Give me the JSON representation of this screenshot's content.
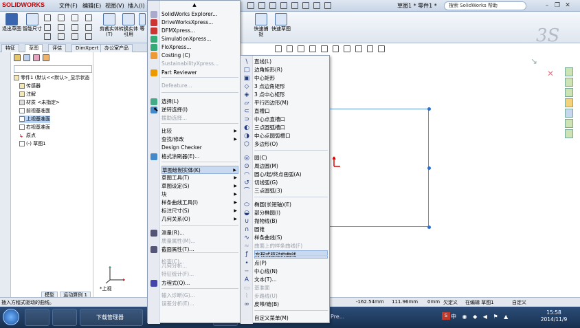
{
  "titlebar": {
    "logo": "SOLIDWORKS",
    "menus": [
      "文件(F)",
      "编辑(E)",
      "视图(V)",
      "插入(I)"
    ],
    "doc_title": "草图1 * 零件1 *",
    "help_search": "搜索 SolidWorks 帮助"
  },
  "cmdbar": {
    "exit_sketch": "退出草图",
    "smart_dim": "智能尺寸",
    "trim": "剪裁实体(T)",
    "convert": "转换实体引用",
    "equal": "等",
    "rapid_snap": "快速捕捉",
    "rapid_sketch": "快速草图"
  },
  "tabs": [
    "特征",
    "草图",
    "评估",
    "DimXpert",
    "办公室产品"
  ],
  "tree": {
    "part": "零件1 (默认<<默认>_显示状态",
    "items": [
      "传感器",
      "注解",
      "材质 <未指定>",
      "前视基准面",
      "上视基准面",
      "右视基准面",
      "原点",
      "(-) 草图1"
    ]
  },
  "mainmenu": {
    "items": [
      {
        "label": "SolidWorks Explorer...",
        "disabled": false
      },
      {
        "label": "DriveWorksXpress...",
        "disabled": false
      },
      {
        "label": "DFMXpress...",
        "disabled": false
      },
      {
        "label": "SimulationXpress...",
        "disabled": false
      },
      {
        "label": "FloXpress...",
        "disabled": false
      },
      {
        "label": "Costing (C)",
        "disabled": false
      },
      {
        "label": "SustainabilityXpress...",
        "disabled": true
      },
      {
        "label": "Part Reviewer",
        "disabled": false
      },
      {
        "label": "Defeature...",
        "disabled": true
      },
      {
        "label": "选择(L)",
        "disabled": false
      },
      {
        "label": "逆转选择(I)",
        "disabled": false
      },
      {
        "label": "援助选择...",
        "disabled": true
      },
      {
        "label": "比较",
        "disabled": false
      },
      {
        "label": "查找/修改",
        "disabled": false
      },
      {
        "label": "Design Checker",
        "disabled": false
      },
      {
        "label": "格式涂刷器(E)...",
        "disabled": false
      },
      {
        "label": "草图绘制实体(K)",
        "disabled": false
      },
      {
        "label": "草图工具(T)",
        "disabled": false
      },
      {
        "label": "草图设定(S)",
        "disabled": false
      },
      {
        "label": "块",
        "disabled": false
      },
      {
        "label": "样条曲线工具(I)",
        "disabled": false
      },
      {
        "label": "标注尺寸(S)",
        "disabled": false
      },
      {
        "label": "几何关系(O)",
        "disabled": false
      },
      {
        "label": "测量(R)...",
        "disabled": false
      },
      {
        "label": "质量属性(M)...",
        "disabled": true
      },
      {
        "label": "截面属性(T)...",
        "disabled": false
      },
      {
        "label": "检查(C)...",
        "disabled": true
      },
      {
        "label": "几何分析...",
        "disabled": true
      },
      {
        "label": "特征统计(F)...",
        "disabled": true
      },
      {
        "label": "方程式(Q)...",
        "disabled": false
      },
      {
        "label": "输入诊断(G)...",
        "disabled": true
      },
      {
        "label": "误差分析(E)...",
        "disabled": true
      }
    ]
  },
  "submenu": {
    "items": [
      {
        "label": "直线(L)",
        "icon": "\\",
        "disabled": false
      },
      {
        "label": "边角矩形(R)",
        "icon": "□",
        "disabled": false
      },
      {
        "label": "中心矩形",
        "icon": "▣",
        "disabled": false
      },
      {
        "label": "3 点边角矩形",
        "icon": "◇",
        "disabled": false
      },
      {
        "label": "3 点中心矩形",
        "icon": "◈",
        "disabled": false
      },
      {
        "label": "平行四边形(M)",
        "icon": "▱",
        "disabled": false
      },
      {
        "label": "直槽口",
        "icon": "⊂",
        "disabled": false
      },
      {
        "label": "中心点直槽口",
        "icon": "⊃",
        "disabled": false
      },
      {
        "label": "三点圆弧槽口",
        "icon": "◐",
        "disabled": false
      },
      {
        "label": "中心点圆弧槽口",
        "icon": "◑",
        "disabled": false
      },
      {
        "label": "多边形(O)",
        "icon": "⬡",
        "disabled": false
      },
      {
        "label": "圆(C)",
        "icon": "◎",
        "disabled": false
      },
      {
        "label": "周边圆(M)",
        "icon": "⊙",
        "disabled": false
      },
      {
        "label": "圆心/起/终点画弧(A)",
        "icon": "◠",
        "disabled": false
      },
      {
        "label": "切线弧(G)",
        "icon": "↺",
        "disabled": false
      },
      {
        "label": "三点圆弧(3)",
        "icon": "⌒",
        "disabled": false
      },
      {
        "label": "椭圆(长短轴)(E)",
        "icon": "⬭",
        "disabled": false
      },
      {
        "label": "部分椭圆(I)",
        "icon": "◒",
        "disabled": false
      },
      {
        "label": "抛物线(B)",
        "icon": "∪",
        "disabled": false
      },
      {
        "label": "圆锥",
        "icon": "∩",
        "disabled": false
      },
      {
        "label": "样条曲线(S)",
        "icon": "∿",
        "disabled": false
      },
      {
        "label": "曲面上的样条曲线(F)",
        "icon": "≈",
        "disabled": true
      },
      {
        "label": "方程式驱动的曲线",
        "icon": "ƒ",
        "disabled": false
      },
      {
        "label": "点(P)",
        "icon": "•",
        "disabled": false
      },
      {
        "label": "中心线(N)",
        "icon": "┄",
        "disabled": false
      },
      {
        "label": "文本(T)...",
        "icon": "A",
        "disabled": false
      },
      {
        "label": "基准面",
        "icon": "▭",
        "disabled": true
      },
      {
        "label": "步路线(U)",
        "icon": "⌇",
        "disabled": true
      },
      {
        "label": "皮带/链(B)",
        "icon": "∞",
        "disabled": false
      },
      {
        "label": "自定义菜单(M)",
        "icon": "",
        "disabled": false
      }
    ]
  },
  "canvas": {
    "view_label": "*上视"
  },
  "bottom_tabs": [
    "模型",
    "运动算例 1"
  ],
  "status": {
    "hint": "插入方程式驱动的曲线。",
    "x": "-162.54mm",
    "y": "111.96mm",
    "z": "0mm",
    "state": "欠定义",
    "editing": "在编辑 草图1",
    "custom": "自定义"
  },
  "taskbar": {
    "app_label": "下载管理器",
    "pre_label": "Pre...",
    "time": "15:58",
    "date": "2014/11/9",
    "ime": "S",
    "tray": "中 ◉ ◆ ◀ ⚑ ▲"
  }
}
